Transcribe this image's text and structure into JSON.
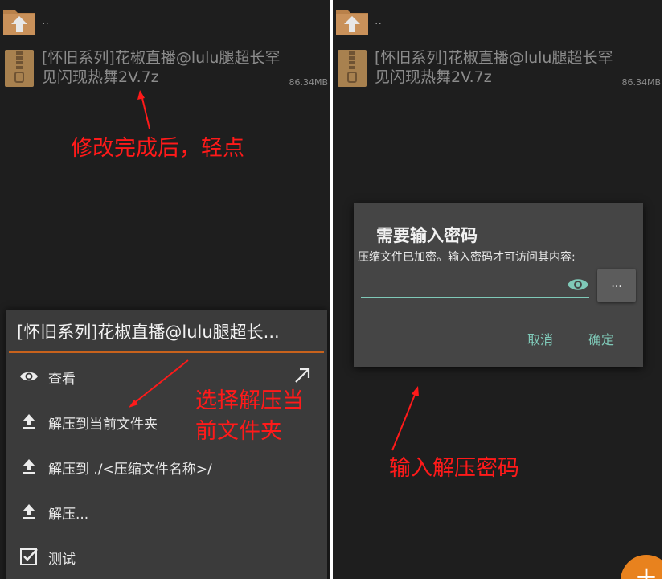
{
  "colors": {
    "background": "#1e1e1e",
    "menu_background": "#3b3b3b",
    "dialog_background": "#454545",
    "accent_orange": "#c8621c",
    "accent_teal": "#7fc9b8",
    "annotation_red": "#ff1a1a",
    "fab_orange": "#e8821e"
  },
  "left": {
    "up_label": "..",
    "file": {
      "name": "[怀旧系列]花椒直播@lulu腿超长罕见闪现热舞2V.7z",
      "size": "86.34MB",
      "icon": "zip-archive-icon"
    },
    "annotation_top": "修改完成后，轻点",
    "annotation_menu_line1": "选择解压当",
    "annotation_menu_line2": "前文件夹",
    "menu": {
      "title": "[怀旧系列]花椒直播@lulu腿超长...",
      "items": [
        {
          "label": "查看",
          "icon": "eye-icon"
        },
        {
          "label": "解压到当前文件夹",
          "icon": "extract-icon"
        },
        {
          "label": "解压到 ./<压缩文件名称>/",
          "icon": "extract-icon"
        },
        {
          "label": "解压...",
          "icon": "extract-icon"
        },
        {
          "label": "测试",
          "icon": "checkbox-icon"
        }
      ]
    }
  },
  "right": {
    "up_label": "..",
    "file": {
      "name": "[怀旧系列]花椒直播@lulu腿超长罕见闪现热舞2V.7z",
      "size": "86.34MB",
      "icon": "zip-archive-icon"
    },
    "dialog": {
      "title": "需要输入密码",
      "message": "压缩文件已加密。输入密码才可访问其内容:",
      "password_value": "",
      "browse_label": "...",
      "cancel_label": "取消",
      "ok_label": "确定"
    },
    "annotation": "输入解压密码",
    "fab_label": "+"
  }
}
